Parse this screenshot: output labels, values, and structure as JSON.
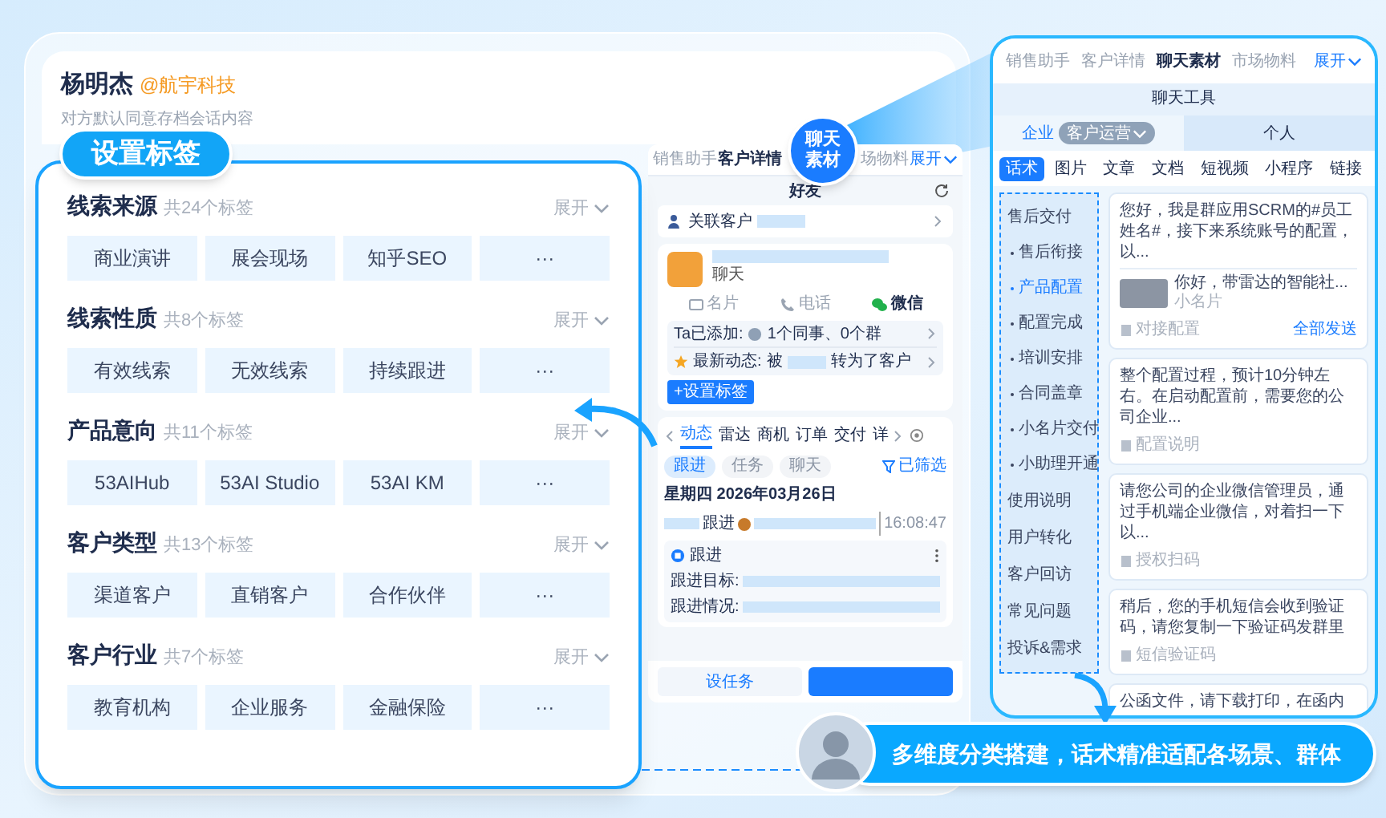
{
  "contact": {
    "name": "杨明杰",
    "company": "@航宇科技",
    "note": "对方默认同意存档会话内容"
  },
  "tag_panel": {
    "title": "设置标签",
    "groups": [
      {
        "name": "线索来源",
        "count": "共24个标签",
        "expand": "展开",
        "tags": [
          "商业演讲",
          "展会现场",
          "知乎SEO",
          "···"
        ]
      },
      {
        "name": "线索性质",
        "count": "共8个标签",
        "expand": "展开",
        "tags": [
          "有效线索",
          "无效线索",
          "持续跟进",
          "···"
        ]
      },
      {
        "name": "产品意向",
        "count": "共11个标签",
        "expand": "展开",
        "tags": [
          "53AIHub",
          "53AI Studio",
          "53AI KM",
          "···"
        ]
      },
      {
        "name": "客户类型",
        "count": "共13个标签",
        "expand": "展开",
        "tags": [
          "渠道客户",
          "直销客户",
          "合作伙伴",
          "···"
        ]
      },
      {
        "name": "客户行业",
        "count": "共7个标签",
        "expand": "展开",
        "tags": [
          "教育机构",
          "企业服务",
          "金融保险",
          "···"
        ]
      }
    ]
  },
  "badge": "聊天素材",
  "customer_panel": {
    "tabs": [
      {
        "label": "销售助手",
        "selected": false
      },
      {
        "label": "客户详情",
        "selected": true
      },
      {
        "label": "场物料",
        "selected": false
      }
    ],
    "expand": "展开",
    "header": "好友",
    "linked_label": "关联客户",
    "card": {
      "subtitle": "聊天",
      "actions": [
        {
          "label": "名片",
          "kind": "card"
        },
        {
          "label": "电话",
          "kind": "phone"
        },
        {
          "label": "微信",
          "kind": "wechat"
        }
      ],
      "added_label": "Ta已添加:",
      "added_value": "1个同事、0个群",
      "latest_label": "最新动态:",
      "latest_prefix": "被",
      "latest_suffix": "转为了客户",
      "tag_button": "+设置标签"
    },
    "activity_tabs": [
      {
        "label": "动态",
        "selected": true
      },
      {
        "label": "雷达",
        "selected": false
      },
      {
        "label": "商机",
        "selected": false
      },
      {
        "label": "订单",
        "selected": false
      },
      {
        "label": "交付",
        "selected": false
      },
      {
        "label": "详",
        "selected": false
      }
    ],
    "filters": [
      {
        "label": "跟进",
        "selected": true
      },
      {
        "label": "任务",
        "selected": false
      },
      {
        "label": "聊天",
        "selected": false
      }
    ],
    "filter_status": "已筛选",
    "date": "星期四 2026年03月26日",
    "event": {
      "action": "跟进",
      "time": "16:08:47"
    },
    "followup": {
      "title": "跟进",
      "fields": [
        "跟进目标:",
        "跟进情况:"
      ]
    },
    "buttons": [
      "设任务"
    ]
  },
  "material_panel": {
    "tabs": [
      {
        "label": "销售助手",
        "selected": false
      },
      {
        "label": "客户详情",
        "selected": false
      },
      {
        "label": "聊天素材",
        "selected": true
      },
      {
        "label": "市场物料",
        "selected": false
      }
    ],
    "expand": "展开",
    "title": "聊天工具",
    "scopes": [
      {
        "label": "企业",
        "selected": true,
        "dropdown": "客户运营"
      },
      {
        "label": "个人",
        "selected": false
      }
    ],
    "types": [
      {
        "label": "话术",
        "selected": true
      },
      {
        "label": "图片",
        "selected": false
      },
      {
        "label": "文章",
        "selected": false
      },
      {
        "label": "文档",
        "selected": false
      },
      {
        "label": "短视频",
        "selected": false
      },
      {
        "label": "小程序",
        "selected": false
      },
      {
        "label": "链接",
        "selected": false
      }
    ],
    "categories": [
      {
        "label": "售后交付",
        "selected": false,
        "children": [
          {
            "label": "售后衔接",
            "selected": false
          },
          {
            "label": "产品配置",
            "selected": true
          },
          {
            "label": "配置完成",
            "selected": false
          },
          {
            "label": "培训安排",
            "selected": false
          },
          {
            "label": "合同盖章",
            "selected": false
          },
          {
            "label": "小名片交付",
            "selected": false
          },
          {
            "label": "小助理开通",
            "selected": false
          }
        ]
      },
      {
        "label": "使用说明",
        "selected": false
      },
      {
        "label": "用户转化",
        "selected": false
      },
      {
        "label": "客户回访",
        "selected": false
      },
      {
        "label": "常见问题",
        "selected": false
      },
      {
        "label": "投诉&需求",
        "selected": false
      }
    ],
    "scripts": [
      {
        "text": "您好，我是群应用SCRM的#员工姓名#，接下来系统账号的配置，以...",
        "attachment": {
          "title": "你好，带雷达的智能社...",
          "subtitle": "小名片"
        },
        "tag": "对接配置",
        "action": "全部发送"
      },
      {
        "text": "整个配置过程，预计10分钟左右。在启动配置前，需要您的公司企业...",
        "tag": "配置说明"
      },
      {
        "text": "请您公司的企业微信管理员，通过手机端企业微信，对着扫一下以...",
        "tag": "授权扫码"
      },
      {
        "text": "稍后，您的手机短信会收到验证码，请您复制一下验证码发群里",
        "tag": "短信验证码"
      },
      {
        "text": "公函文件，请下载打印，在函内"
      }
    ]
  },
  "banner": {
    "text": "多维度分类搭建，话术精准适配各场景、群体"
  }
}
